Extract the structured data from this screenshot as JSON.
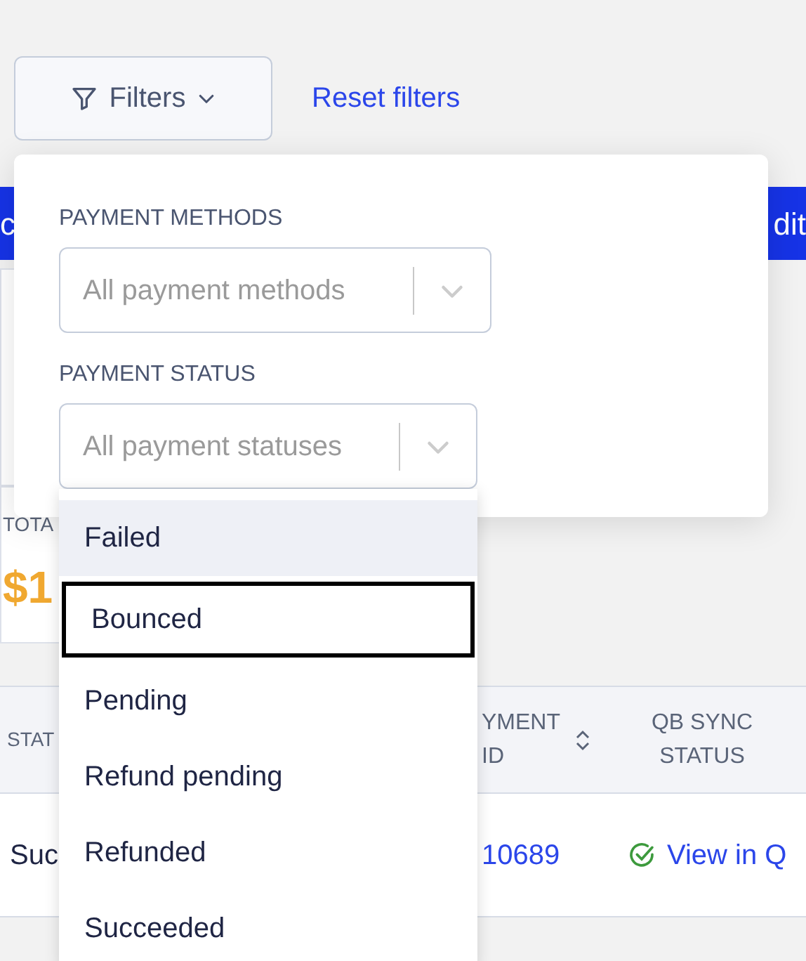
{
  "toolbar": {
    "filters_button": "Filters",
    "reset_link": "Reset filters"
  },
  "banner": {
    "left_text": "c",
    "right_text": "dit"
  },
  "summary_cards": [
    {
      "label": "TOTA",
      "value": "$1",
      "kind": "pending"
    }
  ],
  "table": {
    "columns": [
      "STAT",
      "YMENT ID",
      "QB SYNC STATUS"
    ],
    "rows": [
      {
        "cells": [
          "Suc",
          "10689",
          "View in Q"
        ],
        "synced": true
      }
    ]
  },
  "filter_panel": {
    "sections": [
      {
        "label": "PAYMENT METHODS",
        "placeholder": "All payment methods"
      },
      {
        "label": "PAYMENT STATUS",
        "placeholder": "All payment statuses"
      }
    ]
  },
  "status_menu": {
    "options": [
      {
        "label": "Failed",
        "highlighted": true,
        "outlined": false
      },
      {
        "label": "Bounced",
        "highlighted": false,
        "outlined": true
      },
      {
        "label": "Pending",
        "highlighted": false,
        "outlined": false
      },
      {
        "label": "Refund pending",
        "highlighted": false,
        "outlined": false
      },
      {
        "label": "Refunded",
        "highlighted": false,
        "outlined": false
      },
      {
        "label": "Succeeded",
        "highlighted": false,
        "outlined": false
      }
    ]
  }
}
